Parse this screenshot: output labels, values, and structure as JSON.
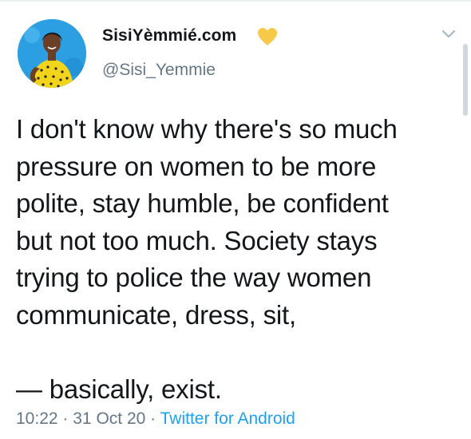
{
  "tweet": {
    "author": {
      "display_name": "SisiYèmmié.com",
      "handle": "@Sisi_Yemmie",
      "badge_icon": "yellow-heart-icon",
      "badge_color": "#f7c948"
    },
    "text": "I don't know why there's so much\npressure on women to be more\npolite, stay humble, be confident\nbut not too much. Society stays\ntrying to police the way women\ncommunicate, dress, sit,\n\n— basically, exist.",
    "time": "10:22",
    "separator": "·",
    "date": "31 Oct 20",
    "source": "Twitter for Android",
    "menu_icon": "chevron-down-icon"
  },
  "colors": {
    "text": "#14171a",
    "muted": "#657786",
    "link": "#1da1f2"
  }
}
